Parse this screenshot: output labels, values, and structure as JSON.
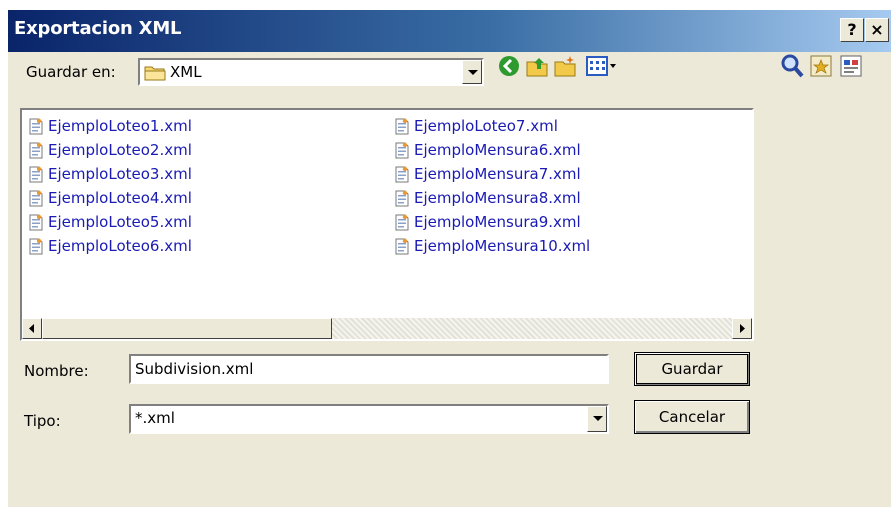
{
  "window": {
    "title": "Exportacion XML",
    "help_label": "?",
    "close_label": "×"
  },
  "location": {
    "label": "Guardar en:",
    "value": "XML"
  },
  "toolbar": {
    "icons": [
      "back-icon",
      "up-folder-icon",
      "new-folder-icon",
      "view-menu-icon"
    ]
  },
  "right_tools": {
    "icons": [
      "search-icon",
      "favorites-icon",
      "properties-icon"
    ]
  },
  "files": {
    "column1": [
      "EjemploLoteo1.xml",
      "EjemploLoteo2.xml",
      "EjemploLoteo3.xml",
      "EjemploLoteo4.xml",
      "EjemploLoteo5.xml",
      "EjemploLoteo6.xml"
    ],
    "column2": [
      "EjemploLoteo7.xml",
      "EjemploMensura6.xml",
      "EjemploMensura7.xml",
      "EjemploMensura8.xml",
      "EjemploMensura9.xml",
      "EjemploMensura10.xml"
    ]
  },
  "filename": {
    "label": "Nombre:",
    "value": "Subdivision.xml"
  },
  "filetype": {
    "label": "Tipo:",
    "value": "*.xml"
  },
  "buttons": {
    "save": "Guardar",
    "cancel": "Cancelar"
  },
  "colors": {
    "title_start": "#0a246a",
    "title_end": "#a6caf0",
    "face": "#ece9d8",
    "file_text": "#1a1ab4"
  }
}
